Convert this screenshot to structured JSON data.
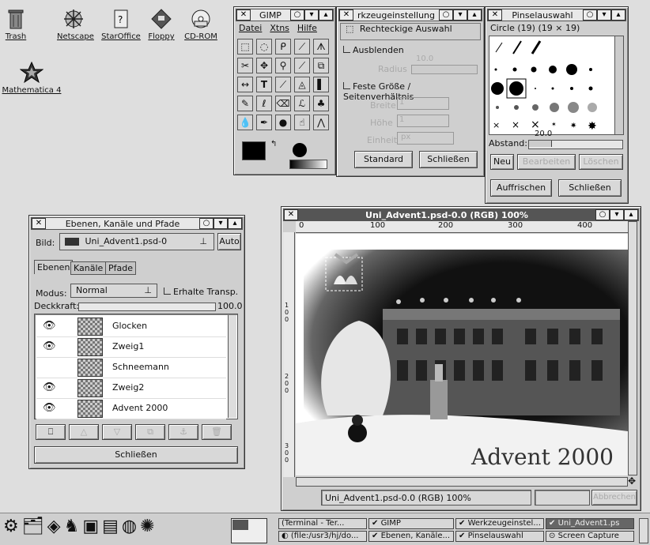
{
  "desktop": {
    "icons": [
      {
        "label": "Trash"
      },
      {
        "label": "Netscape"
      },
      {
        "label": "StarOffice"
      },
      {
        "label": "Floppy"
      },
      {
        "label": "CD-ROM"
      },
      {
        "label": "Mathematica 4"
      }
    ]
  },
  "gimp": {
    "title": "GIMP",
    "menu": [
      "Datei",
      "Xtns",
      "Hilfe"
    ]
  },
  "tool_options": {
    "title": "rkzeugeinstellung",
    "tool_name": "Rechteckige Auswahl",
    "feather_label": "Ausblenden",
    "radius_label": "Radius",
    "radius_value": "10.0",
    "fixed_label": "Feste Größe / Seitenverhältnis",
    "width_label": "Breite",
    "width_value": "1",
    "height_label": "Höhe",
    "height_value": "1",
    "unit_label": "Einheit",
    "unit_value": "px",
    "btn_standard": "Standard",
    "btn_close": "Schließen"
  },
  "brushes": {
    "title": "Pinselauswahl",
    "current": "Circle (19)  (19 × 19)",
    "spacing_label": "Abstand:",
    "spacing_value": "20.0",
    "btn_new": "Neu",
    "btn_edit": "Bearbeiten",
    "btn_delete": "Löschen",
    "btn_refresh": "Auffrischen",
    "btn_close": "Schließen"
  },
  "layers": {
    "title": "Ebenen, Kanäle und Pfade",
    "image_label": "Bild:",
    "image_value": "Uni_Advent1.psd-0",
    "auto_button": "Auto",
    "tabs": [
      "Ebenen",
      "Kanäle",
      "Pfade"
    ],
    "mode_label": "Modus:",
    "mode_value": "Normal",
    "keep_trans_label": "Erhalte Transp.",
    "opacity_label": "Deckkraft:",
    "opacity_value": "100.0",
    "items": [
      {
        "name": "Glocken",
        "visible": true
      },
      {
        "name": "Zweig1",
        "visible": true
      },
      {
        "name": "Schneemann",
        "visible": false
      },
      {
        "name": "Zweig2",
        "visible": true
      },
      {
        "name": "Advent 2000",
        "visible": true
      }
    ],
    "close_button": "Schließen"
  },
  "image_window": {
    "title": "Uni_Advent1.psd-0.0 (RGB) 100%",
    "ruler_marks": [
      "0",
      "100",
      "200",
      "300",
      "400"
    ],
    "vruler_marks": [
      "1 0 0",
      "2 0 0",
      "3 0 0"
    ],
    "status": "Uni_Advent1.psd-0.0 (RGB) 100%",
    "cancel_button": "Abbrechen",
    "artwork_text": "Advent 2000"
  },
  "taskbar": {
    "tasks": [
      {
        "label": "(Terminal - Ter..."
      },
      {
        "label": "GIMP"
      },
      {
        "label": "Werkzeugeinstel..."
      },
      {
        "label": "Uni_Advent1.ps"
      },
      {
        "label": "(file:/usr3/hj/do..."
      },
      {
        "label": "Ebenen, Kanäle..."
      },
      {
        "label": "Pinselauswahl"
      },
      {
        "label": "Screen Capture"
      }
    ]
  }
}
